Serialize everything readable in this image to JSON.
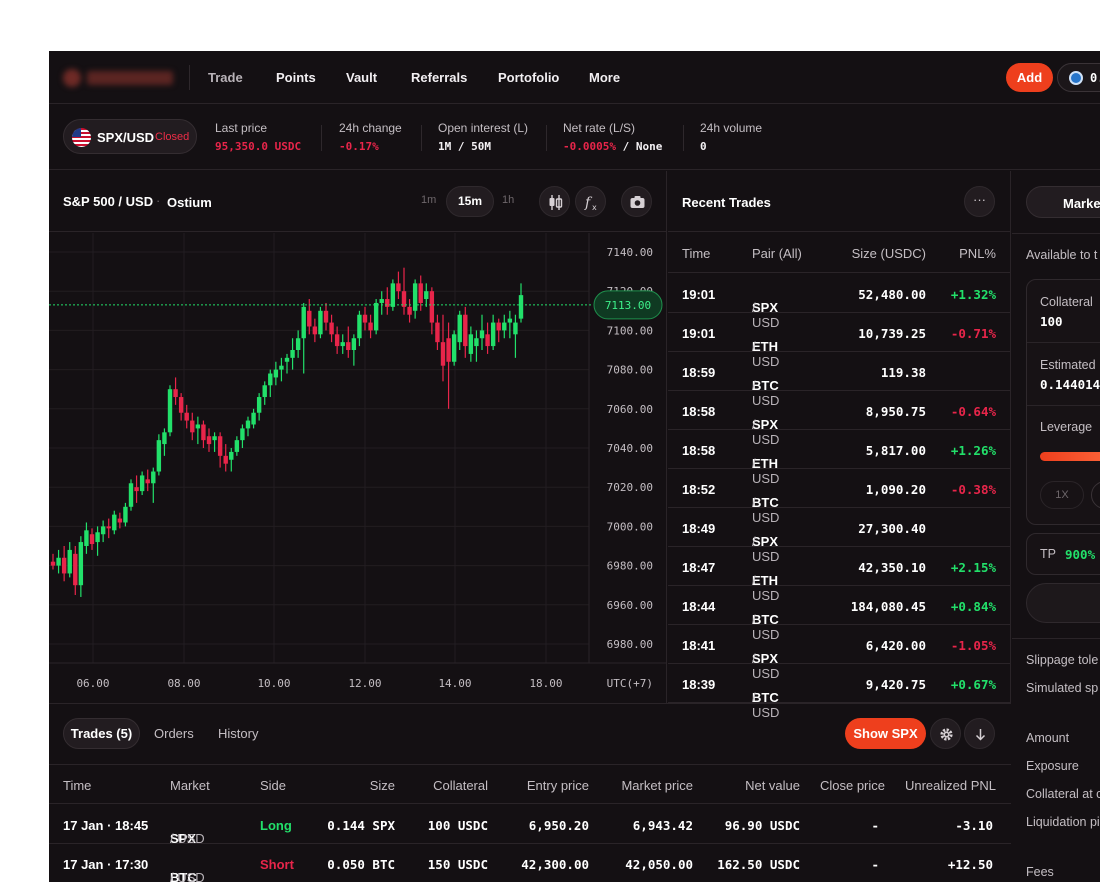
{
  "nav": {
    "items": [
      "Trade",
      "Points",
      "Vault",
      "Referrals",
      "Portofolio",
      "More"
    ],
    "add_label": "Add",
    "wallet_balance": "0."
  },
  "market": {
    "pair": "SPX/USD",
    "status": "Closed",
    "stats": [
      {
        "label": "Last price",
        "value": "95,350.0 USDC",
        "tone": "red"
      },
      {
        "label": "24h change",
        "value": "-0.17%",
        "tone": "red"
      },
      {
        "label": "Open interest (L)",
        "value": "1M / 50M",
        "tone": "white"
      },
      {
        "label": "Net rate (L/S)",
        "value_a": "-0.0005%",
        "value_b": " / None"
      },
      {
        "label": "24h volume",
        "value": "0",
        "tone": "white"
      }
    ]
  },
  "chart_header": {
    "title": "S&P 500 / USD",
    "separator": "·",
    "source": "Ostium",
    "timeframes": [
      "1m",
      "15m",
      "1h"
    ],
    "active_timeframe": "15m"
  },
  "colors": {
    "up": "#22e06a",
    "down": "#e8254a",
    "accent": "#ee3f1d",
    "price_line": "#22e06a"
  },
  "chart_data": {
    "type": "candlestick",
    "x_ticks": [
      "06.00",
      "08.00",
      "10.00",
      "12.00",
      "14.00",
      "18.00"
    ],
    "x_timezone": "UTC(+7)",
    "y_ticks": [
      "7140.00",
      "7120.00",
      "7100.00",
      "7080.00",
      "7060.00",
      "7040.00",
      "7020.00",
      "7000.00",
      "6980.00",
      "6960.00",
      "6980.00"
    ],
    "last_price": "7113.00",
    "last_price_value": 7113.0,
    "ylim": [
      6950,
      7150
    ],
    "candles": [
      [
        6982,
        6986,
        6978,
        6980
      ],
      [
        6980,
        6988,
        6976,
        6984
      ],
      [
        6984,
        6990,
        6972,
        6976
      ],
      [
        6976,
        6992,
        6974,
        6988
      ],
      [
        6986,
        6990,
        6965,
        6970
      ],
      [
        6970,
        6995,
        6964,
        6992
      ],
      [
        6990,
        7002,
        6986,
        6998
      ],
      [
        6996,
        6999,
        6988,
        6991
      ],
      [
        6992,
        7000,
        6985,
        6997
      ],
      [
        6996,
        7003,
        6992,
        7000
      ],
      [
        7000,
        7004,
        6994,
        6999
      ],
      [
        6998,
        7008,
        6996,
        7006
      ],
      [
        7004,
        7007,
        6999,
        7002
      ],
      [
        7002,
        7012,
        7000,
        7010
      ],
      [
        7010,
        7024,
        7008,
        7022
      ],
      [
        7020,
        7026,
        7012,
        7018
      ],
      [
        7018,
        7028,
        7016,
        7026
      ],
      [
        7024,
        7029,
        7018,
        7022
      ],
      [
        7022,
        7030,
        7012,
        7028
      ],
      [
        7028,
        7047,
        7026,
        7044
      ],
      [
        7042,
        7050,
        7036,
        7048
      ],
      [
        7048,
        7072,
        7046,
        7070
      ],
      [
        7070,
        7076,
        7062,
        7066
      ],
      [
        7066,
        7068,
        7054,
        7058
      ],
      [
        7058,
        7062,
        7050,
        7054
      ],
      [
        7054,
        7058,
        7044,
        7048
      ],
      [
        7050,
        7056,
        7042,
        7052
      ],
      [
        7052,
        7054,
        7040,
        7044
      ],
      [
        7046,
        7050,
        7038,
        7042
      ],
      [
        7044,
        7048,
        7038,
        7046
      ],
      [
        7046,
        7048,
        7030,
        7036
      ],
      [
        7036,
        7042,
        7028,
        7032
      ],
      [
        7034,
        7040,
        7028,
        7038
      ],
      [
        7038,
        7046,
        7036,
        7044
      ],
      [
        7044,
        7052,
        7040,
        7050
      ],
      [
        7050,
        7056,
        7046,
        7054
      ],
      [
        7052,
        7060,
        7050,
        7058
      ],
      [
        7058,
        7068,
        7054,
        7066
      ],
      [
        7066,
        7074,
        7062,
        7072
      ],
      [
        7072,
        7080,
        7066,
        7078
      ],
      [
        7076,
        7084,
        7072,
        7080
      ],
      [
        7080,
        7086,
        7074,
        7082
      ],
      [
        7084,
        7088,
        7078,
        7086
      ],
      [
        7086,
        7096,
        7080,
        7090
      ],
      [
        7090,
        7100,
        7086,
        7096
      ],
      [
        7096,
        7114,
        7078,
        7112
      ],
      [
        7110,
        7116,
        7098,
        7102
      ],
      [
        7102,
        7106,
        7094,
        7098
      ],
      [
        7098,
        7112,
        7096,
        7110
      ],
      [
        7110,
        7114,
        7100,
        7104
      ],
      [
        7104,
        7108,
        7094,
        7098
      ],
      [
        7098,
        7102,
        7088,
        7092
      ],
      [
        7092,
        7098,
        7088,
        7094
      ],
      [
        7094,
        7102,
        7086,
        7090
      ],
      [
        7090,
        7098,
        7082,
        7096
      ],
      [
        7096,
        7110,
        7092,
        7108
      ],
      [
        7108,
        7112,
        7100,
        7104
      ],
      [
        7104,
        7108,
        7096,
        7100
      ],
      [
        7100,
        7116,
        7098,
        7114
      ],
      [
        7114,
        7120,
        7108,
        7116
      ],
      [
        7116,
        7122,
        7108,
        7112
      ],
      [
        7112,
        7126,
        7110,
        7124
      ],
      [
        7124,
        7130,
        7116,
        7120
      ],
      [
        7120,
        7132,
        7108,
        7112
      ],
      [
        7112,
        7116,
        7104,
        7108
      ],
      [
        7110,
        7126,
        7106,
        7124
      ],
      [
        7124,
        7128,
        7110,
        7114
      ],
      [
        7116,
        7124,
        7112,
        7120
      ],
      [
        7120,
        7122,
        7098,
        7104
      ],
      [
        7104,
        7108,
        7090,
        7094
      ],
      [
        7094,
        7108,
        7074,
        7082
      ],
      [
        7096,
        7104,
        7060,
        7084
      ],
      [
        7084,
        7100,
        7082,
        7098
      ],
      [
        7094,
        7110,
        7090,
        7108
      ],
      [
        7108,
        7112,
        7086,
        7092
      ],
      [
        7088,
        7102,
        7084,
        7098
      ],
      [
        7092,
        7100,
        7084,
        7096
      ],
      [
        7096,
        7108,
        7090,
        7100
      ],
      [
        7098,
        7104,
        7088,
        7092
      ],
      [
        7092,
        7108,
        7090,
        7104
      ],
      [
        7104,
        7106,
        7094,
        7100
      ],
      [
        7100,
        7108,
        7096,
        7104
      ],
      [
        7104,
        7110,
        7096,
        7106
      ],
      [
        7098,
        7108,
        7086,
        7104
      ],
      [
        7106,
        7124,
        7104,
        7118
      ]
    ]
  },
  "recent_trades": {
    "title": "Recent Trades",
    "columns": [
      "Time",
      "Pair (All)",
      "Size (USDC)",
      "PNL%"
    ],
    "rows": [
      {
        "time": "19:01",
        "base": "SPX",
        "quote": " / USD",
        "size": "52,480.00",
        "pnl": "+1.32%",
        "tone": "green"
      },
      {
        "time": "19:01",
        "base": "ETH",
        "quote": " / USD",
        "size": "10,739.25",
        "pnl": "-0.71%",
        "tone": "red"
      },
      {
        "time": "18:59",
        "base": "BTC",
        "quote": " / USD",
        "size": "119.38",
        "pnl": "",
        "tone": "white"
      },
      {
        "time": "18:58",
        "base": "SPX",
        "quote": " / USD",
        "size": "8,950.75",
        "pnl": "-0.64%",
        "tone": "red"
      },
      {
        "time": "18:58",
        "base": "ETH",
        "quote": " / USD",
        "size": "5,817.00",
        "pnl": "+1.26%",
        "tone": "green"
      },
      {
        "time": "18:52",
        "base": "BTC",
        "quote": " / USD",
        "size": "1,090.20",
        "pnl": "-0.38%",
        "tone": "red"
      },
      {
        "time": "18:49",
        "base": "SPX",
        "quote": " / USD",
        "size": "27,300.40",
        "pnl": "",
        "tone": "white"
      },
      {
        "time": "18:47",
        "base": "ETH",
        "quote": " / USD",
        "size": "42,350.10",
        "pnl": "+2.15%",
        "tone": "green"
      },
      {
        "time": "18:44",
        "base": "BTC",
        "quote": " / USD",
        "size": "184,080.45",
        "pnl": "+0.84%",
        "tone": "green"
      },
      {
        "time": "18:41",
        "base": "SPX",
        "quote": " / USD",
        "size": "6,420.00",
        "pnl": "-1.05%",
        "tone": "red"
      },
      {
        "time": "18:39",
        "base": "BTC",
        "quote": " / USD",
        "size": "9,420.75",
        "pnl": "+0.67%",
        "tone": "green"
      }
    ]
  },
  "order_panel": {
    "tab_label": "Market",
    "available_label": "Available to t",
    "collateral_label": "Collateral",
    "collateral_value": "100",
    "estimated_label": "Estimated",
    "estimated_value": "0.144014",
    "leverage_label": "Leverage",
    "leverage_1x": "1X",
    "tp_label": "TP",
    "tp_value": "900%",
    "slippage_label": "Slippage tole",
    "simulated_label": "Simulated sp",
    "amount_label": "Amount",
    "exposure_label": "Exposure",
    "collateral_at_label": "Collateral at c",
    "liquidation_label": "Liquidation pi",
    "fees_label": "Fees"
  },
  "positions": {
    "tabs": [
      "Trades (5)",
      "Orders",
      "History"
    ],
    "show_button": "Show SPX",
    "columns": [
      "Time",
      "Market",
      "Side",
      "Size",
      "Collateral",
      "Entry price",
      "Market price",
      "Net value",
      "Close price",
      "Unrealized PNL"
    ],
    "rows": [
      {
        "time": "17 Jan · 18:45",
        "base": "SPX",
        "quote": " / USD",
        "side": "Long",
        "side_tone": "green",
        "size": "0.144 SPX",
        "collateral": "100 USDC",
        "entry": "6,950.20",
        "market": "6,943.42",
        "net": "96.90 USDC",
        "close": "-",
        "pnl": "-3.10",
        "pnl_tone": "red"
      },
      {
        "time": "17 Jan · 17:30",
        "base": "BTC",
        "quote": " / USD",
        "side": "Short",
        "side_tone": "red",
        "size": "0.050 BTC",
        "collateral": "150 USDC",
        "entry": "42,300.00",
        "market": "42,050.00",
        "net": "162.50 USDC",
        "close": "-",
        "pnl": "+12.50",
        "pnl_tone": "green"
      }
    ]
  }
}
